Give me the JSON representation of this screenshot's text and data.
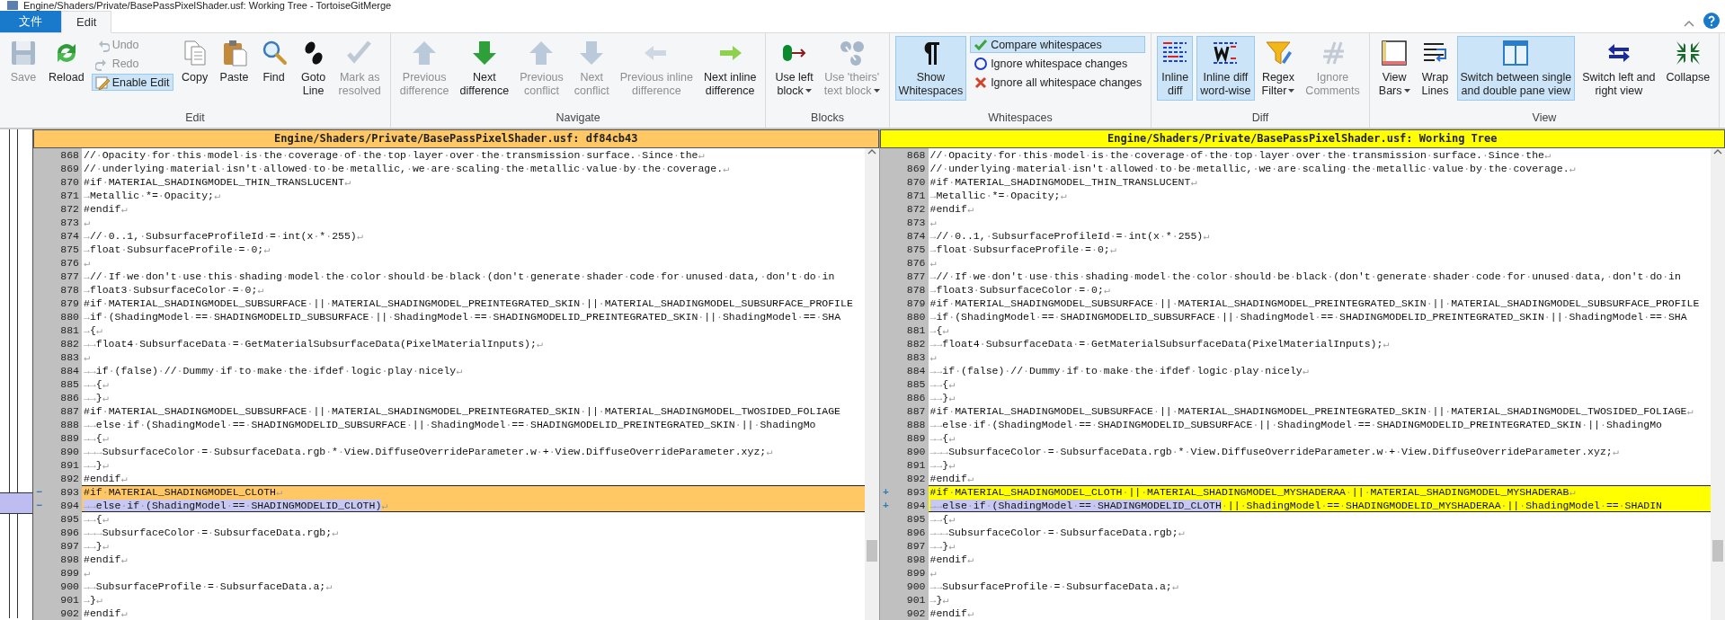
{
  "window": {
    "title": "Engine/Shaders/Private/BasePassPixelShader.usf: Working Tree - TortoiseGitMerge"
  },
  "ribbon_tabs": [
    {
      "label": "文件",
      "kind": "file",
      "selected": false
    },
    {
      "label": "Edit",
      "kind": "tab",
      "selected": true
    }
  ],
  "ribbon_groups": [
    {
      "label": "Edit",
      "items": [
        {
          "kind": "large",
          "label": "Save",
          "disabled": true,
          "pressed": false
        },
        {
          "kind": "large",
          "label": "Reload",
          "disabled": false,
          "pressed": false
        },
        {
          "kind": "stack",
          "items": [
            {
              "label": "Undo",
              "disabled": true,
              "pressed": false
            },
            {
              "label": "Redo",
              "disabled": true,
              "pressed": false
            },
            {
              "label": "Enable Edit",
              "disabled": false,
              "pressed": true
            }
          ]
        },
        {
          "kind": "large",
          "label": "Copy",
          "disabled": false,
          "pressed": false
        },
        {
          "kind": "large",
          "label": "Paste",
          "disabled": false,
          "pressed": false
        },
        {
          "kind": "large",
          "label": "Find",
          "disabled": false,
          "pressed": false
        },
        {
          "kind": "large",
          "label": "Goto\nLine",
          "disabled": false,
          "pressed": false
        },
        {
          "kind": "large",
          "label": "Mark as\nresolved",
          "disabled": true,
          "pressed": false
        }
      ]
    },
    {
      "label": "Navigate",
      "items": [
        {
          "kind": "large",
          "label": "Previous\ndifference",
          "disabled": true,
          "pressed": false
        },
        {
          "kind": "large",
          "label": "Next\ndifference",
          "disabled": false,
          "pressed": false
        },
        {
          "kind": "large",
          "label": "Previous\nconflict",
          "disabled": true,
          "pressed": false
        },
        {
          "kind": "large",
          "label": "Next\nconflict",
          "disabled": true,
          "pressed": false
        },
        {
          "kind": "large",
          "label": "Previous inline\ndifference",
          "disabled": true,
          "pressed": false
        },
        {
          "kind": "large",
          "label": "Next inline\ndifference",
          "disabled": false,
          "pressed": false
        }
      ]
    },
    {
      "label": "Blocks",
      "items": [
        {
          "kind": "large",
          "label": "Use left\nblock",
          "disabled": false,
          "pressed": false,
          "dropdown": true
        },
        {
          "kind": "large",
          "label": "Use 'theirs'\ntext block",
          "disabled": true,
          "pressed": false,
          "dropdown": true
        }
      ]
    },
    {
      "label": "Whitespaces",
      "items": [
        {
          "kind": "large",
          "label": "Show\nWhitespaces",
          "disabled": false,
          "pressed": true
        },
        {
          "kind": "stack",
          "items": [
            {
              "label": "Compare whitespaces",
              "disabled": false,
              "pressed": true
            },
            {
              "label": "Ignore whitespace changes",
              "disabled": false,
              "pressed": false
            },
            {
              "label": "Ignore all whitespace changes",
              "disabled": false,
              "pressed": false
            }
          ]
        }
      ]
    },
    {
      "label": "Diff",
      "items": [
        {
          "kind": "large",
          "label": "Inline\ndiff",
          "disabled": false,
          "pressed": true
        },
        {
          "kind": "large",
          "label": "Inline diff\nword-wise",
          "disabled": false,
          "pressed": true
        },
        {
          "kind": "large",
          "label": "Regex\nFilter",
          "disabled": false,
          "pressed": false,
          "dropdown": true
        },
        {
          "kind": "large",
          "label": "Ignore\nComments",
          "disabled": true,
          "pressed": false
        }
      ]
    },
    {
      "label": "View",
      "items": [
        {
          "kind": "large",
          "label": "View\nBars",
          "disabled": false,
          "pressed": false,
          "dropdown": true
        },
        {
          "kind": "large",
          "label": "Wrap\nLines",
          "disabled": false,
          "pressed": false
        },
        {
          "kind": "large",
          "label": "Switch between single\nand double pane view",
          "disabled": false,
          "pressed": true
        },
        {
          "kind": "large",
          "label": "Switch left and\nright view",
          "disabled": false,
          "pressed": false
        },
        {
          "kind": "large",
          "label": "Collapse",
          "disabled": false,
          "pressed": false
        }
      ]
    }
  ],
  "panes": [
    {
      "kind": "base",
      "header": "Engine/Shaders/Private/BasePassPixelShader.usf: df84cb43",
      "lines": [
        {
          "number": "868",
          "kind": "normal",
          "text": "//·Opacity·for·this·model·is·the·coverage·of·the·top·layer·over·the·transmission·surface.·Since·the↵"
        },
        {
          "number": "869",
          "kind": "normal",
          "text": "//·underlying·material·isn't·allowed·to·be·metallic,·we·are·scaling·the·metallic·value·by·the·coverage.↵"
        },
        {
          "number": "870",
          "kind": "normal",
          "text": "#if·MATERIAL_SHADINGMODEL_THIN_TRANSLUCENT↵"
        },
        {
          "number": "871",
          "kind": "normal",
          "text": "→Metallic·*=·Opacity;↵"
        },
        {
          "number": "872",
          "kind": "normal",
          "text": "#endif↵"
        },
        {
          "number": "873",
          "kind": "normal",
          "text": "↵"
        },
        {
          "number": "874",
          "kind": "normal",
          "text": "→//·0..1,·SubsurfaceProfileId·=·int(x·*·255)↵"
        },
        {
          "number": "875",
          "kind": "normal",
          "text": "→float·SubsurfaceProfile·=·0;↵"
        },
        {
          "number": "876",
          "kind": "normal",
          "text": "↵"
        },
        {
          "number": "877",
          "kind": "normal",
          "text": "→//·If·we·don't·use·this·shading·model·the·color·should·be·black·(don't·generate·shader·code·for·unused·data,·don't·do·in"
        },
        {
          "number": "878",
          "kind": "normal",
          "text": "→float3·SubsurfaceColor·=·0;↵"
        },
        {
          "number": "879",
          "kind": "normal",
          "text": "#if·MATERIAL_SHADINGMODEL_SUBSURFACE·||·MATERIAL_SHADINGMODEL_PREINTEGRATED_SKIN·||·MATERIAL_SHADINGMODEL_SUBSURFACE_PROFILE"
        },
        {
          "number": "880",
          "kind": "normal",
          "text": "→if·(ShadingModel·==·SHADINGMODELID_SUBSURFACE·||·ShadingModel·==·SHADINGMODELID_PREINTEGRATED_SKIN·||·ShadingModel·==·SHA"
        },
        {
          "number": "881",
          "kind": "normal",
          "text": "→{↵"
        },
        {
          "number": "882",
          "kind": "normal",
          "text": "→→float4·SubsurfaceData·=·GetMaterialSubsurfaceData(PixelMaterialInputs);↵"
        },
        {
          "number": "883",
          "kind": "normal",
          "text": "↵"
        },
        {
          "number": "884",
          "kind": "normal",
          "text": "→→if·(false)·//·Dummy·if·to·make·the·ifdef·logic·play·nicely↵"
        },
        {
          "number": "885",
          "kind": "normal",
          "text": "→→{↵"
        },
        {
          "number": "886",
          "kind": "normal",
          "text": "→→}↵"
        },
        {
          "number": "887",
          "kind": "normal",
          "text": "#if·MATERIAL_SHADINGMODEL_SUBSURFACE·||·MATERIAL_SHADINGMODEL_PREINTEGRATED_SKIN·||·MATERIAL_SHADINGMODEL_TWOSIDED_FOLIAGE"
        },
        {
          "number": "888",
          "kind": "normal",
          "text": "→→else·if·(ShadingModel·==·SHADINGMODELID_SUBSURFACE·||·ShadingModel·==·SHADINGMODELID_PREINTEGRATED_SKIN·||·ShadingMo"
        },
        {
          "number": "889",
          "kind": "normal",
          "text": "→→{↵"
        },
        {
          "number": "890",
          "kind": "normal",
          "text": "→→→SubsurfaceColor·=·SubsurfaceData.rgb·*·View.DiffuseOverrideParameter.w·+·View.DiffuseOverrideParameter.xyz;↵"
        },
        {
          "number": "891",
          "kind": "normal",
          "text": "→→}↵"
        },
        {
          "number": "892",
          "kind": "normal",
          "text": "#endif↵"
        },
        {
          "number": "893",
          "kind": "removed",
          "marker": "−",
          "text": "#if·MATERIAL_SHADINGMODEL_CLOTH↵"
        },
        {
          "number": "894",
          "kind": "removed",
          "marker": "−",
          "segments": [
            {
              "text": "→→else·if·(ShadingModel·==·SHADINGMODELID_CLOTH)",
              "changed": true
            },
            {
              "text": "↵",
              "changed": false
            }
          ]
        },
        {
          "number": "895",
          "kind": "normal",
          "text": "→→{↵"
        },
        {
          "number": "896",
          "kind": "normal",
          "text": "→→→SubsurfaceColor·=·SubsurfaceData.rgb;↵"
        },
        {
          "number": "897",
          "kind": "normal",
          "text": "→→}↵"
        },
        {
          "number": "898",
          "kind": "normal",
          "text": "#endif↵"
        },
        {
          "number": "899",
          "kind": "normal",
          "text": "↵"
        },
        {
          "number": "900",
          "kind": "normal",
          "text": "→→SubsurfaceProfile·=·SubsurfaceData.a;↵"
        },
        {
          "number": "901",
          "kind": "normal",
          "text": "→}↵"
        },
        {
          "number": "902",
          "kind": "normal",
          "text": "#endif↵"
        }
      ]
    },
    {
      "kind": "working",
      "header": "Engine/Shaders/Private/BasePassPixelShader.usf: Working Tree",
      "lines": [
        {
          "number": "868",
          "kind": "normal",
          "text": "//·Opacity·for·this·model·is·the·coverage·of·the·top·layer·over·the·transmission·surface.·Since·the↵"
        },
        {
          "number": "869",
          "kind": "normal",
          "text": "//·underlying·material·isn't·allowed·to·be·metallic,·we·are·scaling·the·metallic·value·by·the·coverage.↵"
        },
        {
          "number": "870",
          "kind": "normal",
          "text": "#if·MATERIAL_SHADINGMODEL_THIN_TRANSLUCENT↵"
        },
        {
          "number": "871",
          "kind": "normal",
          "text": "→Metallic·*=·Opacity;↵"
        },
        {
          "number": "872",
          "kind": "normal",
          "text": "#endif↵"
        },
        {
          "number": "873",
          "kind": "normal",
          "text": "↵"
        },
        {
          "number": "874",
          "kind": "normal",
          "text": "→//·0..1,·SubsurfaceProfileId·=·int(x·*·255)↵"
        },
        {
          "number": "875",
          "kind": "normal",
          "text": "→float·SubsurfaceProfile·=·0;↵"
        },
        {
          "number": "876",
          "kind": "normal",
          "text": "↵"
        },
        {
          "number": "877",
          "kind": "normal",
          "text": "→//·If·we·don't·use·this·shading·model·the·color·should·be·black·(don't·generate·shader·code·for·unused·data,·don't·do·in"
        },
        {
          "number": "878",
          "kind": "normal",
          "text": "→float3·SubsurfaceColor·=·0;↵"
        },
        {
          "number": "879",
          "kind": "normal",
          "text": "#if·MATERIAL_SHADINGMODEL_SUBSURFACE·||·MATERIAL_SHADINGMODEL_PREINTEGRATED_SKIN·||·MATERIAL_SHADINGMODEL_SUBSURFACE_PROFILE"
        },
        {
          "number": "880",
          "kind": "normal",
          "text": "→if·(ShadingModel·==·SHADINGMODELID_SUBSURFACE·||·ShadingModel·==·SHADINGMODELID_PREINTEGRATED_SKIN·||·ShadingModel·==·SHA"
        },
        {
          "number": "881",
          "kind": "normal",
          "text": "→{↵"
        },
        {
          "number": "882",
          "kind": "normal",
          "text": "→→float4·SubsurfaceData·=·GetMaterialSubsurfaceData(PixelMaterialInputs);↵"
        },
        {
          "number": "883",
          "kind": "normal",
          "text": "↵"
        },
        {
          "number": "884",
          "kind": "normal",
          "text": "→→if·(false)·//·Dummy·if·to·make·the·ifdef·logic·play·nicely↵"
        },
        {
          "number": "885",
          "kind": "normal",
          "text": "→→{↵"
        },
        {
          "number": "886",
          "kind": "normal",
          "text": "→→}↵"
        },
        {
          "number": "887",
          "kind": "normal",
          "text": "#if·MATERIAL_SHADINGMODEL_SUBSURFACE·||·MATERIAL_SHADINGMODEL_PREINTEGRATED_SKIN·||·MATERIAL_SHADINGMODEL_TWOSIDED_FOLIAGE↵"
        },
        {
          "number": "888",
          "kind": "normal",
          "text": "→→else·if·(ShadingModel·==·SHADINGMODELID_SUBSURFACE·||·ShadingModel·==·SHADINGMODELID_PREINTEGRATED_SKIN·||·ShadingMo"
        },
        {
          "number": "889",
          "kind": "normal",
          "text": "→→{↵"
        },
        {
          "number": "890",
          "kind": "normal",
          "text": "→→→SubsurfaceColor·=·SubsurfaceData.rgb·*·View.DiffuseOverrideParameter.w·+·View.DiffuseOverrideParameter.xyz;↵"
        },
        {
          "number": "891",
          "kind": "normal",
          "text": "→→}↵"
        },
        {
          "number": "892",
          "kind": "normal",
          "text": "#endif↵"
        },
        {
          "number": "893",
          "kind": "added",
          "marker": "+",
          "text": "#if·MATERIAL_SHADINGMODEL_CLOTH·||·MATERIAL_SHADINGMODEL_MYSHADERAA·||·MATERIAL_SHADINGMODEL_MYSHADERAB↵"
        },
        {
          "number": "894",
          "kind": "added",
          "marker": "+",
          "segments": [
            {
              "text": "→→else·if·(ShadingModel·==·SHADINGMODELID_CLOTH",
              "changed": true
            },
            {
              "text": "·||·ShadingModel·==·SHADINGMODELID_MYSHADERAA·||·ShadingModel·==·SHADIN",
              "changed": false
            }
          ]
        },
        {
          "number": "895",
          "kind": "normal",
          "text": "→→{↵"
        },
        {
          "number": "896",
          "kind": "normal",
          "text": "→→→SubsurfaceColor·=·SubsurfaceData.rgb;↵"
        },
        {
          "number": "897",
          "kind": "normal",
          "text": "→→}↵"
        },
        {
          "number": "898",
          "kind": "normal",
          "text": "#endif↵"
        },
        {
          "number": "899",
          "kind": "normal",
          "text": "↵"
        },
        {
          "number": "900",
          "kind": "normal",
          "text": "→→SubsurfaceProfile·=·SubsurfaceData.a;↵"
        },
        {
          "number": "901",
          "kind": "normal",
          "text": "→}↵"
        },
        {
          "number": "902",
          "kind": "normal",
          "text": "#endif↵"
        }
      ]
    }
  ]
}
